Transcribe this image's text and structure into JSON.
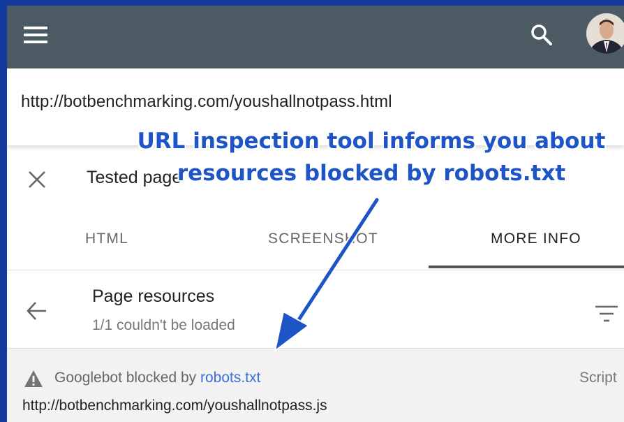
{
  "appbar": {
    "menu_icon": "hamburger-menu-icon",
    "search_icon": "search-icon",
    "avatar": "user-avatar"
  },
  "url_bar": {
    "value": "http://botbenchmarking.com/youshallnotpass.html"
  },
  "annotation": {
    "line1": "URL inspection tool informs you about",
    "line2": "resources blocked by robots.txt",
    "color": "#1d54c6"
  },
  "dialog": {
    "close_icon": "close-icon",
    "title": "Tested page"
  },
  "tabs": [
    {
      "label": "HTML",
      "active": false
    },
    {
      "label": "SCREENSHOT",
      "active": false
    },
    {
      "label": "MORE INFO",
      "active": true
    }
  ],
  "resources": {
    "back_icon": "arrow-back-icon",
    "title": "Page resources",
    "subtitle": "1/1 couldn't be loaded",
    "filter_icon": "filter-icon",
    "items": [
      {
        "warning_icon": "warning-icon",
        "status_prefix": "Googlebot blocked by ",
        "status_link": "robots.txt",
        "type": "Script",
        "url": "http://botbenchmarking.com/youshallnotpass.js"
      }
    ]
  },
  "colors": {
    "background": "#123a9c",
    "appbar": "#4b5a63",
    "link": "#3a6ed8"
  }
}
